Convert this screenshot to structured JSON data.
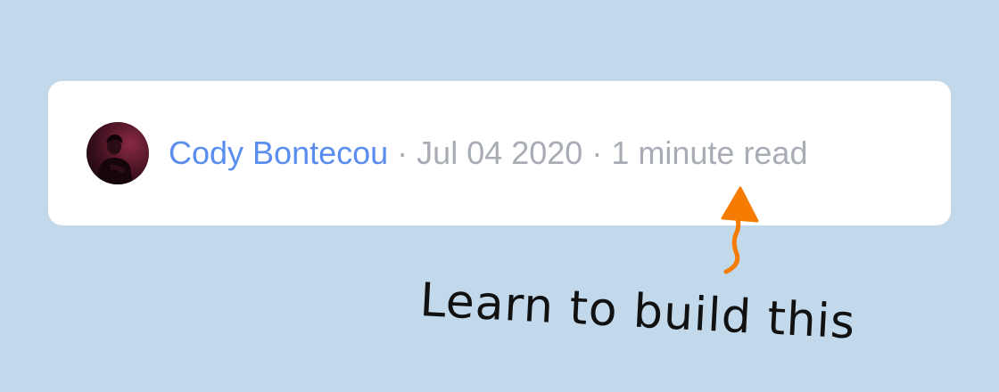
{
  "post_meta": {
    "author": "Cody Bontecou",
    "separator": "·",
    "date": "Jul 04 2020",
    "read_time": "1 minute read"
  },
  "annotation": {
    "text": "Learn to build this"
  },
  "colors": {
    "background": "#c2d9eb",
    "card": "#ffffff",
    "author_link": "#5b8def",
    "muted_text": "#a8acb4",
    "arrow": "#f57c00",
    "handwriting": "#111111"
  },
  "icons": {
    "avatar": "author-photo",
    "arrow": "hand-drawn-arrow-up"
  }
}
